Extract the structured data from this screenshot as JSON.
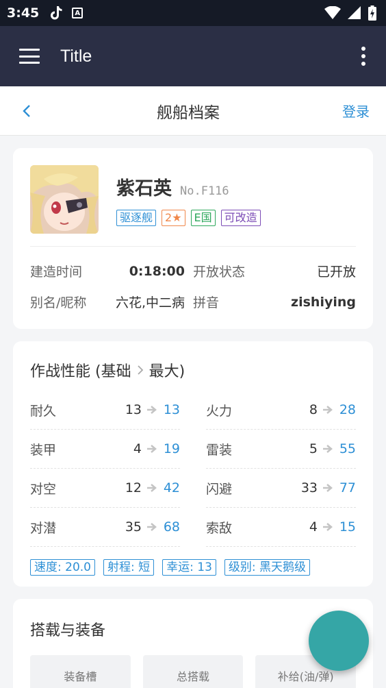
{
  "status_bar": {
    "time": "3:45",
    "a_icon_letter": "A"
  },
  "app_bar": {
    "title": "Title"
  },
  "nav": {
    "title": "舰船档案",
    "login": "登录"
  },
  "ship": {
    "name": "紫石英",
    "number": "No.F116",
    "tags": [
      {
        "label": "驱逐舰",
        "color": "#2d8fd5"
      },
      {
        "label": "2★",
        "color": "#f0874a"
      },
      {
        "label": "E国",
        "color": "#2ea85c"
      },
      {
        "label": "可改造",
        "color": "#7b4bb5"
      }
    ],
    "info": [
      {
        "label": "建造时间",
        "value": "0:18:00"
      },
      {
        "label": "开放状态",
        "value": "已开放"
      },
      {
        "label": "别名/昵称",
        "value": "六花,中二病"
      },
      {
        "label": "拼音",
        "value": "zishiying"
      }
    ]
  },
  "performance": {
    "title_prefix": "作战性能 (基础",
    "title_suffix": "最大)",
    "stats": [
      {
        "label": "耐久",
        "base": "13",
        "max": "13"
      },
      {
        "label": "火力",
        "base": "8",
        "max": "28"
      },
      {
        "label": "装甲",
        "base": "4",
        "max": "19"
      },
      {
        "label": "雷装",
        "base": "5",
        "max": "55"
      },
      {
        "label": "对空",
        "base": "12",
        "max": "42"
      },
      {
        "label": "闪避",
        "base": "33",
        "max": "77"
      },
      {
        "label": "对潜",
        "base": "35",
        "max": "68"
      },
      {
        "label": "索敌",
        "base": "4",
        "max": "15"
      }
    ],
    "badges": [
      "速度: 20.0",
      "射程: 短",
      "幸运: 13",
      "级别: 黑天鹅级"
    ]
  },
  "equipment": {
    "title": "搭载与装备",
    "columns": [
      "装备槽",
      "总搭载",
      "补给(油/弹)"
    ]
  },
  "colors": {
    "accent": "#2d8fd5",
    "app_bar": "#2b2f45",
    "status_bar": "#151a26",
    "fab": "#35a6a6"
  }
}
